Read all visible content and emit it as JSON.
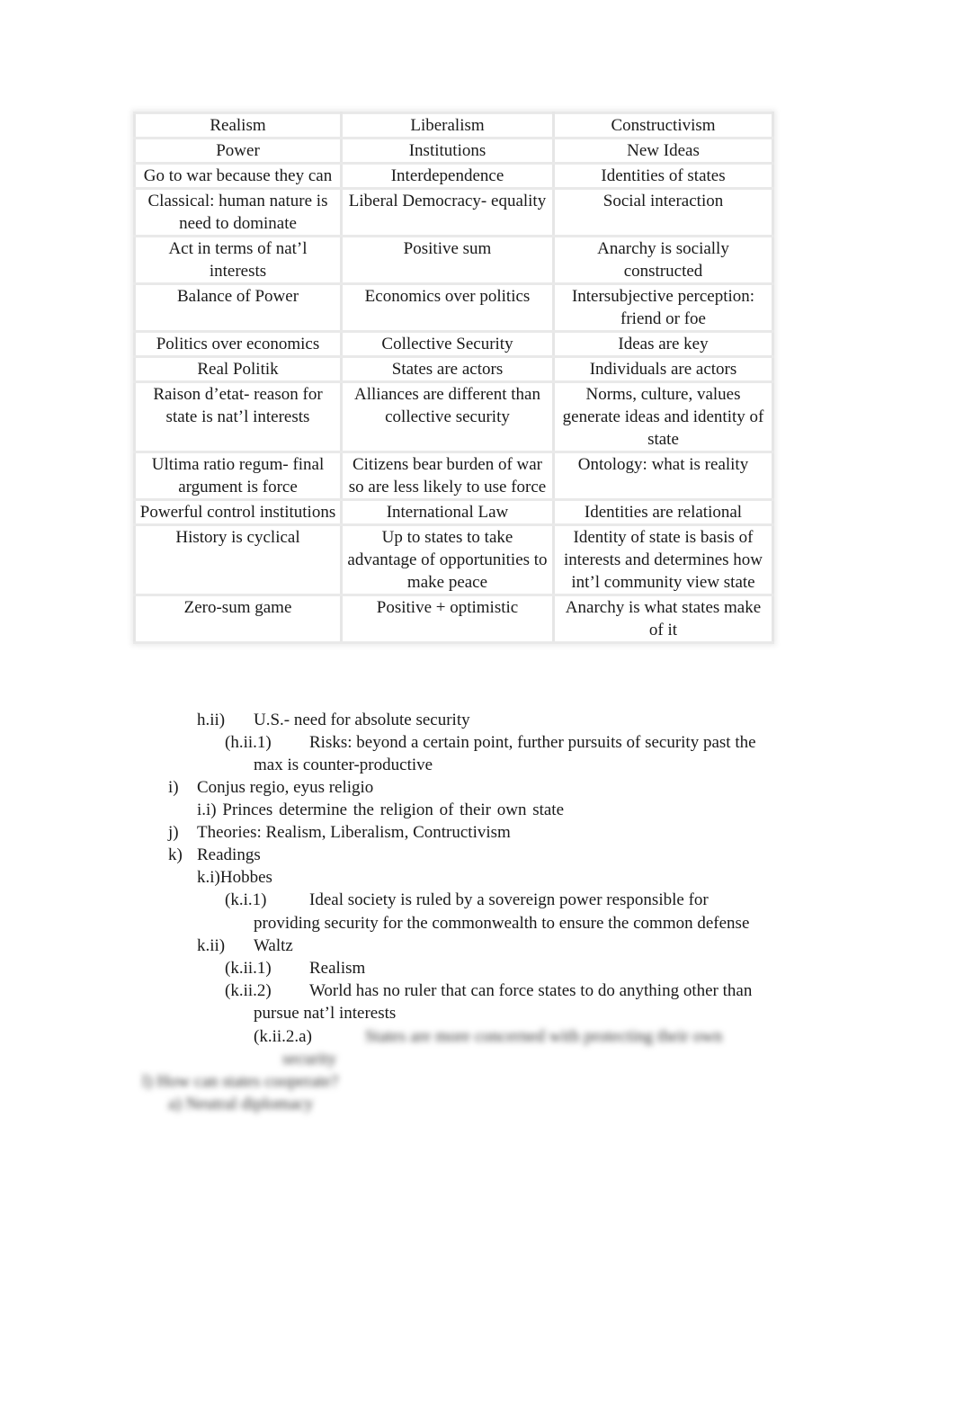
{
  "table": {
    "headers": [
      "Realism",
      "Liberalism",
      "Constructivism"
    ],
    "rows": [
      [
        "Power",
        "Institutions",
        "New Ideas"
      ],
      [
        "Go to war because they can",
        "Interdependence",
        "Identities of states"
      ],
      [
        "Classical: human nature is need to dominate",
        "Liberal Democracy- equality",
        "Social interaction"
      ],
      [
        "Act in terms of nat’l interests",
        "Positive sum",
        "Anarchy is socially constructed"
      ],
      [
        "Balance of Power",
        "Economics over politics",
        "Intersubjective perception: friend or foe"
      ],
      [
        "Politics over economics",
        "Collective Security",
        "Ideas are key"
      ],
      [
        "Real Politik",
        "States are actors",
        "Individuals are actors"
      ],
      [
        "Raison d’etat- reason for state is nat’l interests",
        "Alliances are different than collective security",
        "Norms, culture, values generate ideas and identity of state"
      ],
      [
        "Ultima ratio regum- final argument is force",
        "Citizens bear burden of war so are less likely to use force",
        "Ontology: what is reality"
      ],
      [
        "Powerful control institutions",
        "International Law",
        "Identities are relational"
      ],
      [
        "History is cyclical",
        "Up to states to take advantage of opportunities to make peace",
        "Identity of state is basis of interests and determines how int’l community view state"
      ],
      [
        "Zero-sum game",
        "Positive + optimistic",
        "Anarchy is what states make of it"
      ]
    ]
  },
  "outline": {
    "h_ii": {
      "label": "h.ii)",
      "text": "U.S.- need for absolute security"
    },
    "h_ii_1": {
      "label": "(h.ii.1)",
      "text": "Risks: beyond a certain point, further pursuits of security past the",
      "cont": "max is counter-productive"
    },
    "i": {
      "label": "i)",
      "text": "Conjus regio, eyus religio"
    },
    "i_i": {
      "text": "i.i) Princes determine the religion of their own state"
    },
    "j": {
      "label": "j)",
      "text": "Theories: Realism, Liberalism, Contructivism"
    },
    "k": {
      "label": "k)",
      "text": "Readings"
    },
    "k_i": {
      "text": "k.i)Hobbes"
    },
    "k_i_1": {
      "label": "(k.i.1)",
      "text": "Ideal society is ruled by a sovereign power responsible for",
      "cont": "providing security for the commonwealth to ensure the common defense"
    },
    "k_ii": {
      "label": "k.ii)",
      "text": "Waltz"
    },
    "k_ii_1": {
      "label": "(k.ii.1)",
      "text": "Realism"
    },
    "k_ii_2": {
      "label": "(k.ii.2)",
      "text": "World has no ruler that can force states to do anything other than",
      "cont": "pursue nat’l interests"
    },
    "k_ii_2_a": {
      "label": "(k.ii.2.a)"
    }
  },
  "blurred_preview": {
    "line1": "States are more concerned with protecting their own",
    "line2": "security",
    "line3": "l) How can states cooperate?",
    "line4": "a) Neutral diplomacy"
  }
}
